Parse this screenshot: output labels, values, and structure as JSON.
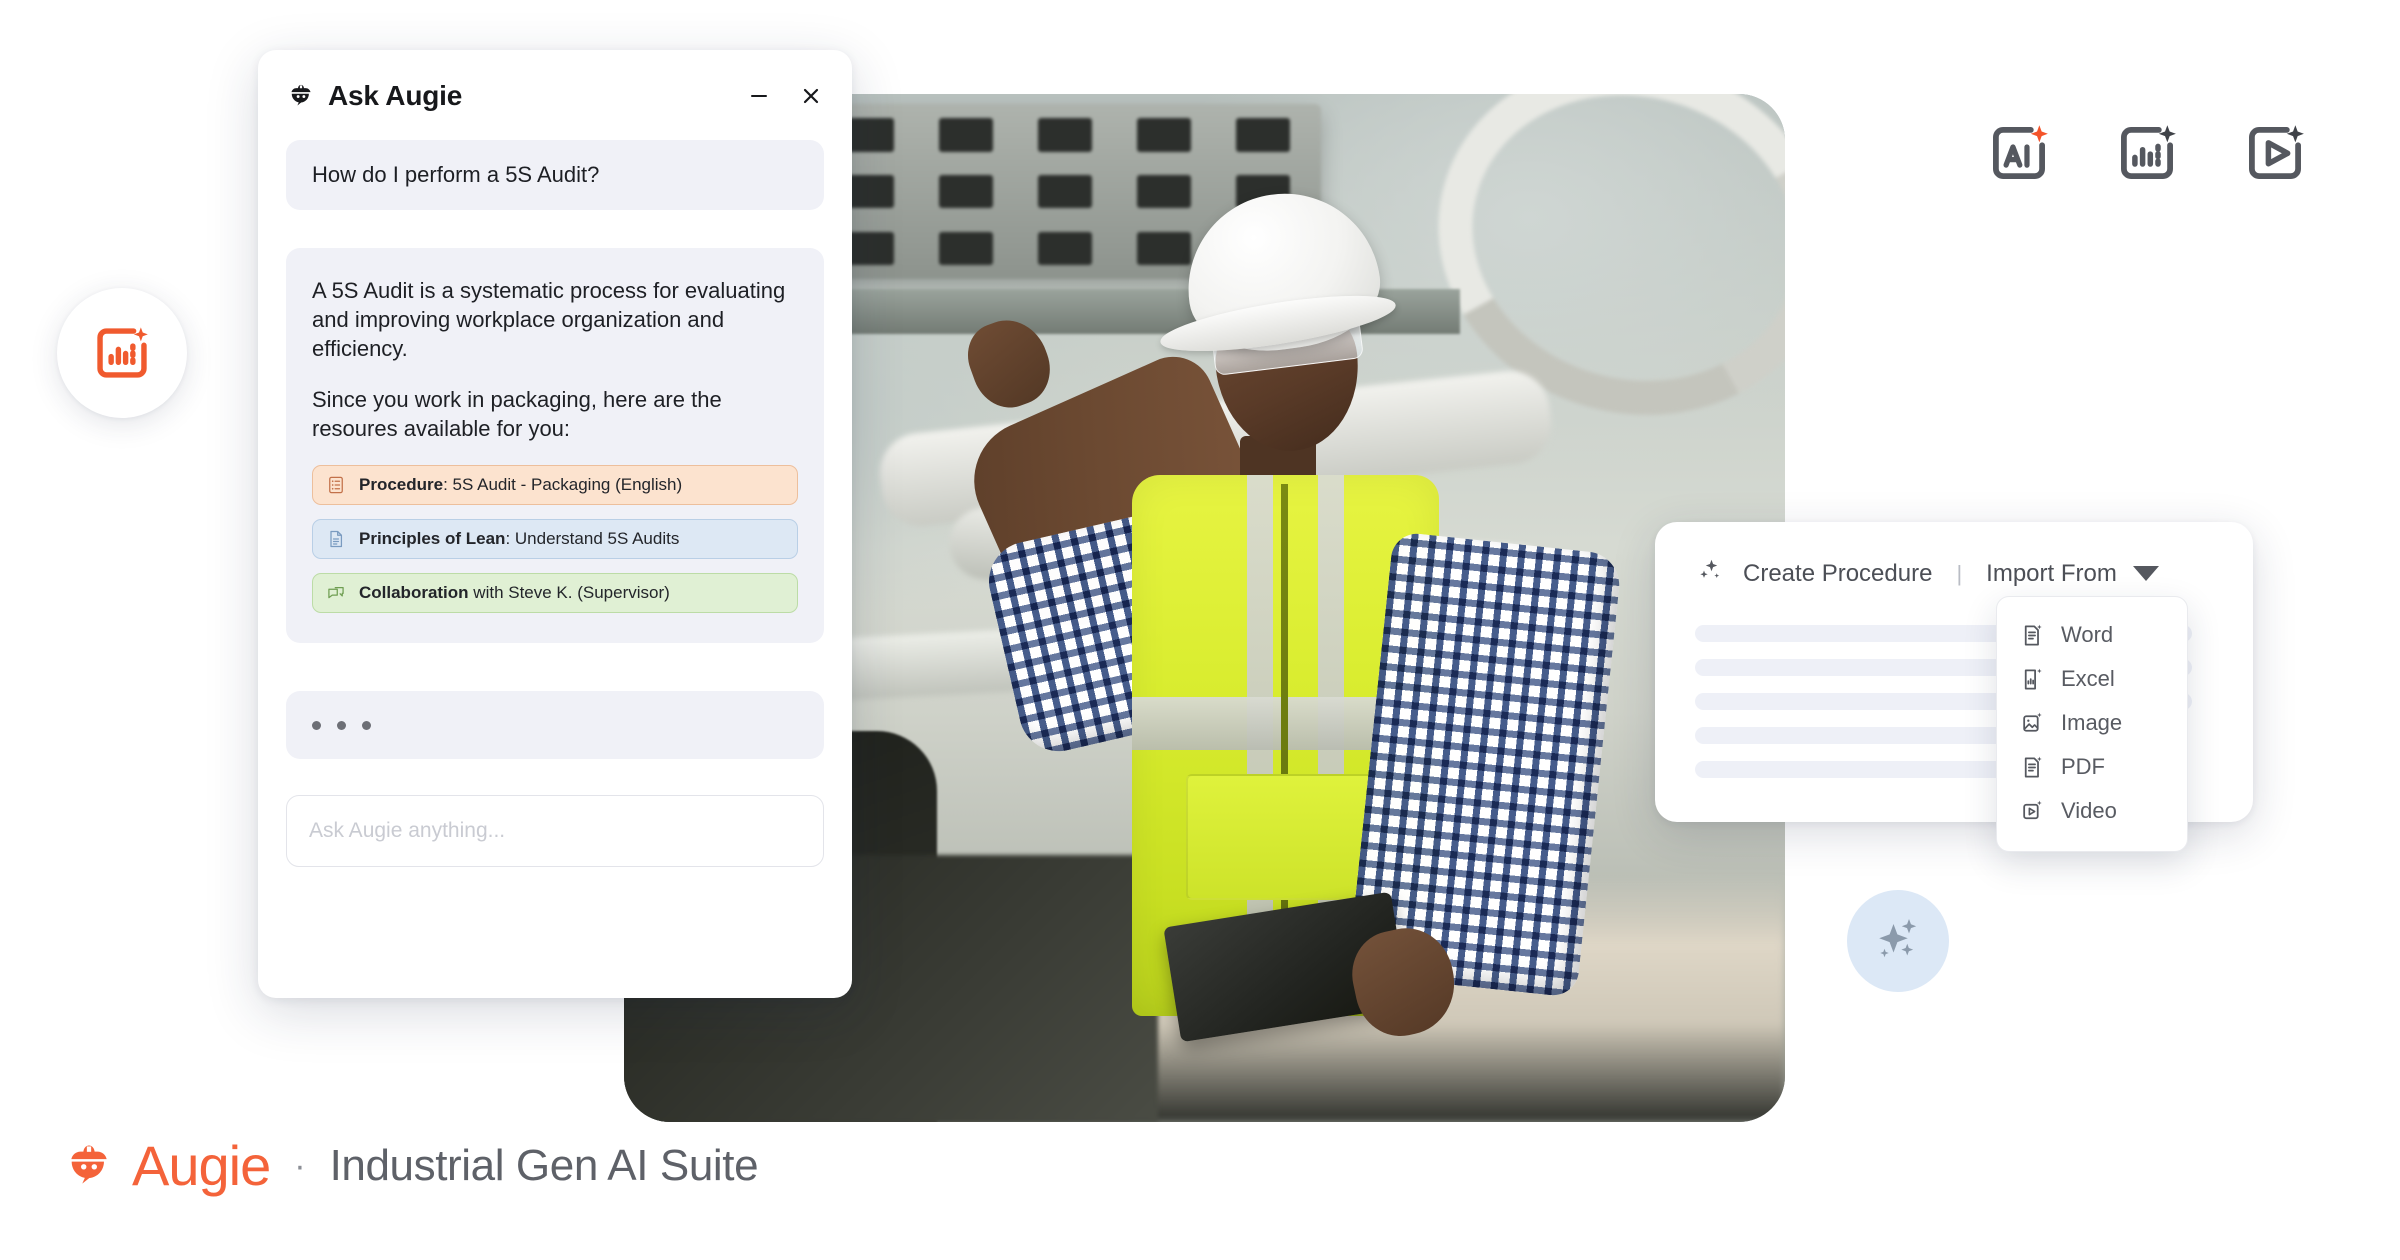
{
  "chat": {
    "title": "Ask Augie",
    "title_icon": "hardhat-mascot-icon",
    "minimize_label": "–",
    "close_label": "✕",
    "user_message": "How do I perform a 5S Audit?",
    "bot_paragraph_1": "A 5S Audit is a systematic process for evaluating and improving workplace organization and efficiency.",
    "bot_paragraph_2": "Since you work in packaging, here are the resoures available for you:",
    "resources": [
      {
        "label": "Procedure",
        "detail": ": 5S Audit - Packaging (English)",
        "icon": "checklist-icon",
        "color": "#fce3cf",
        "border": "#edbf9c"
      },
      {
        "label": "Principles of Lean",
        "detail": ": Understand 5S Audits",
        "icon": "document-icon",
        "color": "#dde8f4",
        "border": "#b9cfe6"
      },
      {
        "label": "Collaboration",
        "detail": " with Steve K. (Supervisor)",
        "icon": "chat-bubbles-icon",
        "color": "#e0f0d4",
        "border": "#bcdca6"
      }
    ],
    "typing_indicator": "typing-dots",
    "input_placeholder": "Ask Augie anything..."
  },
  "toolbar_icons": [
    {
      "name": "ai-sparkle-icon",
      "label": "AI",
      "sparkle_color": "#f4542a"
    },
    {
      "name": "chart-sparkle-icon",
      "label": "Chart",
      "sparkle_color": "#55585f"
    },
    {
      "name": "video-sparkle-icon",
      "label": "Video",
      "sparkle_color": "#55585f"
    }
  ],
  "left_badge": {
    "icon": "chart-sparkle-icon",
    "color": "#f05a2e"
  },
  "create_procedure": {
    "sparkle_icon": "sparkles-icon",
    "create_label": "Create Procedure",
    "separator": "|",
    "import_label": "Import From",
    "caret_icon": "chevron-down-icon",
    "skeleton_lines": 5
  },
  "import_dropdown": {
    "items": [
      {
        "label": "Word",
        "icon": "word-doc-sparkle-icon"
      },
      {
        "label": "Excel",
        "icon": "excel-sheet-sparkle-icon"
      },
      {
        "label": "Image",
        "icon": "image-sparkle-icon"
      },
      {
        "label": "PDF",
        "icon": "pdf-doc-sparkle-icon"
      },
      {
        "label": "Video",
        "icon": "video-play-sparkle-icon"
      }
    ]
  },
  "sparkle_badge": {
    "icon": "sparkles-icon",
    "bg": "#dce8f6",
    "fg": "#8b9aab"
  },
  "photo": {
    "alt": "Industrial worker in white hard hat, safety goggles, plaid shirt and yellow high-visibility vest holding a tablet in a factory"
  },
  "brand": {
    "logo_icon": "augie-hardhat-logo-icon",
    "name": "Augie",
    "separator": "·",
    "tagline": "Industrial Gen AI Suite",
    "accent": "#f4633a"
  }
}
